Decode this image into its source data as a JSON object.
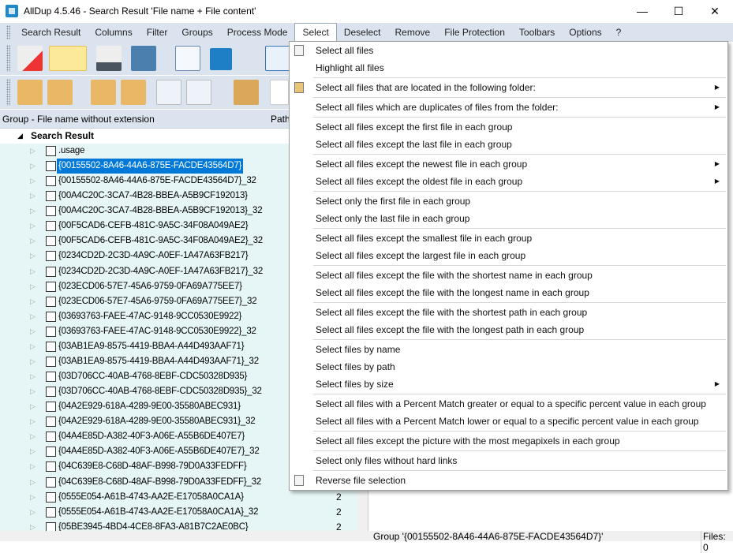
{
  "window": {
    "title": "AllDup 4.5.46 - Search Result 'File name + File content'",
    "minimize": "—",
    "maximize": "☐",
    "close": "✕"
  },
  "menubar": [
    "Search Result",
    "Columns",
    "Filter",
    "Groups",
    "Process Mode",
    "Select",
    "Deselect",
    "Remove",
    "File Protection",
    "Toolbars",
    "Options",
    "?"
  ],
  "columns": {
    "group": "Group - File name without extension",
    "path": "Path"
  },
  "tree": {
    "root": "Search Result",
    "rows": [
      {
        "name": ".usage",
        "count": ""
      },
      {
        "name": "{00155502-8A46-44A6-875E-FACDE43564D7}",
        "count": "",
        "selected": true
      },
      {
        "name": "{00155502-8A46-44A6-875E-FACDE43564D7}_32",
        "count": ""
      },
      {
        "name": "{00A4C20C-3CA7-4B28-BBEA-A5B9CF192013}",
        "count": ""
      },
      {
        "name": "{00A4C20C-3CA7-4B28-BBEA-A5B9CF192013}_32",
        "count": ""
      },
      {
        "name": "{00F5CAD6-CEFB-481C-9A5C-34F08A049AE2}",
        "count": ""
      },
      {
        "name": "{00F5CAD6-CEFB-481C-9A5C-34F08A049AE2}_32",
        "count": ""
      },
      {
        "name": "{0234CD2D-2C3D-4A9C-A0EF-1A47A63FB217}",
        "count": ""
      },
      {
        "name": "{0234CD2D-2C3D-4A9C-A0EF-1A47A63FB217}_32",
        "count": ""
      },
      {
        "name": "{023ECD06-57E7-45A6-9759-0FA69A775EE7}",
        "count": ""
      },
      {
        "name": "{023ECD06-57E7-45A6-9759-0FA69A775EE7}_32",
        "count": ""
      },
      {
        "name": "{03693763-FAEE-47AC-9148-9CC0530E9922}",
        "count": ""
      },
      {
        "name": "{03693763-FAEE-47AC-9148-9CC0530E9922}_32",
        "count": ""
      },
      {
        "name": "{03AB1EA9-8575-4419-BBA4-A44D493AAF71}",
        "count": ""
      },
      {
        "name": "{03AB1EA9-8575-4419-BBA4-A44D493AAF71}_32",
        "count": ""
      },
      {
        "name": "{03D706CC-40AB-4768-8EBF-CDC50328D935}",
        "count": ""
      },
      {
        "name": "{03D706CC-40AB-4768-8EBF-CDC50328D935}_32",
        "count": ""
      },
      {
        "name": "{04A2E929-618A-4289-9E00-35580ABEC931}",
        "count": ""
      },
      {
        "name": "{04A2E929-618A-4289-9E00-35580ABEC931}_32",
        "count": ""
      },
      {
        "name": "{04A4E85D-A382-40F3-A06E-A55B6DE407E7}",
        "count": ""
      },
      {
        "name": "{04A4E85D-A382-40F3-A06E-A55B6DE407E7}_32",
        "count": ""
      },
      {
        "name": "{04C639E8-C68D-48AF-B998-79D0A33FEDFF}",
        "count": ""
      },
      {
        "name": "{04C639E8-C68D-48AF-B998-79D0A33FEDFF}_32",
        "count": ""
      },
      {
        "name": "{0555E054-A61B-4743-AA2E-E17058A0CA1A}",
        "count": "2"
      },
      {
        "name": "{0555E054-A61B-4743-AA2E-E17058A0CA1A}_32",
        "count": "2"
      },
      {
        "name": "{05BE3945-4BD4-4CE8-8FA3-A81B7C2AE0BC}",
        "count": "2"
      }
    ]
  },
  "status": {
    "group": "Group '{00155502-8A46-44A6-875E-FACDE43564D7}'",
    "files": "Files: 0"
  },
  "select_menu": [
    [
      {
        "label": "Select all files",
        "icon": "file-select-icon"
      },
      {
        "label": "Highlight all files"
      }
    ],
    [
      {
        "label": "Select all files that are located in the following folder:",
        "icon": "folder-select-icon",
        "submenu": true
      }
    ],
    [
      {
        "label": "Select all files which are duplicates of files from the folder:",
        "submenu": true
      }
    ],
    [
      {
        "label": "Select all files except the first file in each group"
      },
      {
        "label": "Select all files except the last file in each group"
      }
    ],
    [
      {
        "label": "Select all files except the newest file in each group",
        "submenu": true
      },
      {
        "label": "Select all files except the oldest file in each group",
        "submenu": true
      }
    ],
    [
      {
        "label": "Select only the first file in each group"
      },
      {
        "label": "Select only the last file in each group"
      }
    ],
    [
      {
        "label": "Select all files except the smallest file in each group"
      },
      {
        "label": "Select all files except the largest file in each group"
      }
    ],
    [
      {
        "label": "Select all files except the file with the shortest name in each group"
      },
      {
        "label": "Select all files except the file with the longest name in each group"
      }
    ],
    [
      {
        "label": "Select all files except the file with the shortest path in each group"
      },
      {
        "label": "Select all files except the file with the longest path in each group"
      }
    ],
    [
      {
        "label": "Select files by name"
      },
      {
        "label": "Select files by path"
      },
      {
        "label": "Select files by size",
        "submenu": true
      }
    ],
    [
      {
        "label": "Select all files with a Percent Match greater or equal to a specific percent value in each group"
      },
      {
        "label": "Select all files with a Percent Match lower or equal to a specific percent value in each group"
      }
    ],
    [
      {
        "label": "Select all files except the picture with the most megapixels in each group"
      }
    ],
    [
      {
        "label": "Select only files without hard links"
      }
    ],
    [
      {
        "label": "Reverse file selection",
        "icon": "reverse-selection-icon"
      }
    ]
  ]
}
